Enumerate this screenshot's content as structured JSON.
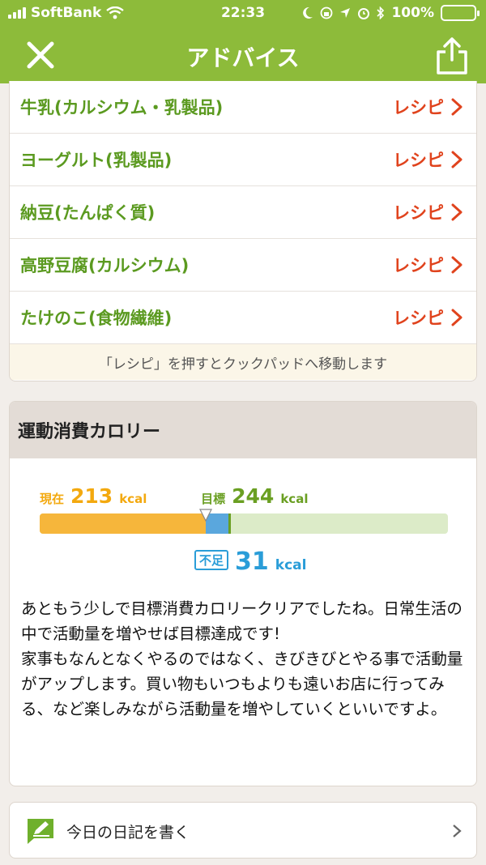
{
  "status_bar": {
    "carrier": "SoftBank",
    "time": "22:33",
    "battery": "100%"
  },
  "nav": {
    "title": "アドバイス"
  },
  "foods": [
    {
      "name": "牛乳(カルシウム・乳製品)",
      "link": "レシピ"
    },
    {
      "name": "ヨーグルト(乳製品)",
      "link": "レシピ"
    },
    {
      "name": "納豆(たんぱく質)",
      "link": "レシピ"
    },
    {
      "name": "高野豆腐(カルシウム)",
      "link": "レシピ"
    },
    {
      "name": "たけのこ(食物繊維)",
      "link": "レシピ"
    }
  ],
  "recipe_note": "「レシピ」を押すとクックパッドへ移動します",
  "calorie": {
    "title": "運動消費カロリー",
    "current_label": "現在",
    "current_value": "213",
    "goal_label": "目標",
    "goal_value": "244",
    "unit": "kcal",
    "shortfall_label": "不足",
    "shortfall_value": "31",
    "bar": {
      "current": 213,
      "goal": 244,
      "max": 523
    },
    "advice": "あともう少しで目標消費カロリークリアでしたね。日常生活の中で活動量を増やせば目標達成です!\n家事もなんとなくやるのではなく、きびきびとやる事で活動量がアップします。買い物もいつもよりも遠いお店に行ってみる、など楽しみながら活動量を増やしていくといいですよ。"
  },
  "diary": {
    "label": "今日の日記を書く"
  },
  "colors": {
    "header": "#8dbb3a",
    "food_name": "#5b9a20",
    "recipe": "#e0431d",
    "current": "#f6b63b",
    "shortfall": "#5aa7dd",
    "goal": "#6a9f22"
  }
}
